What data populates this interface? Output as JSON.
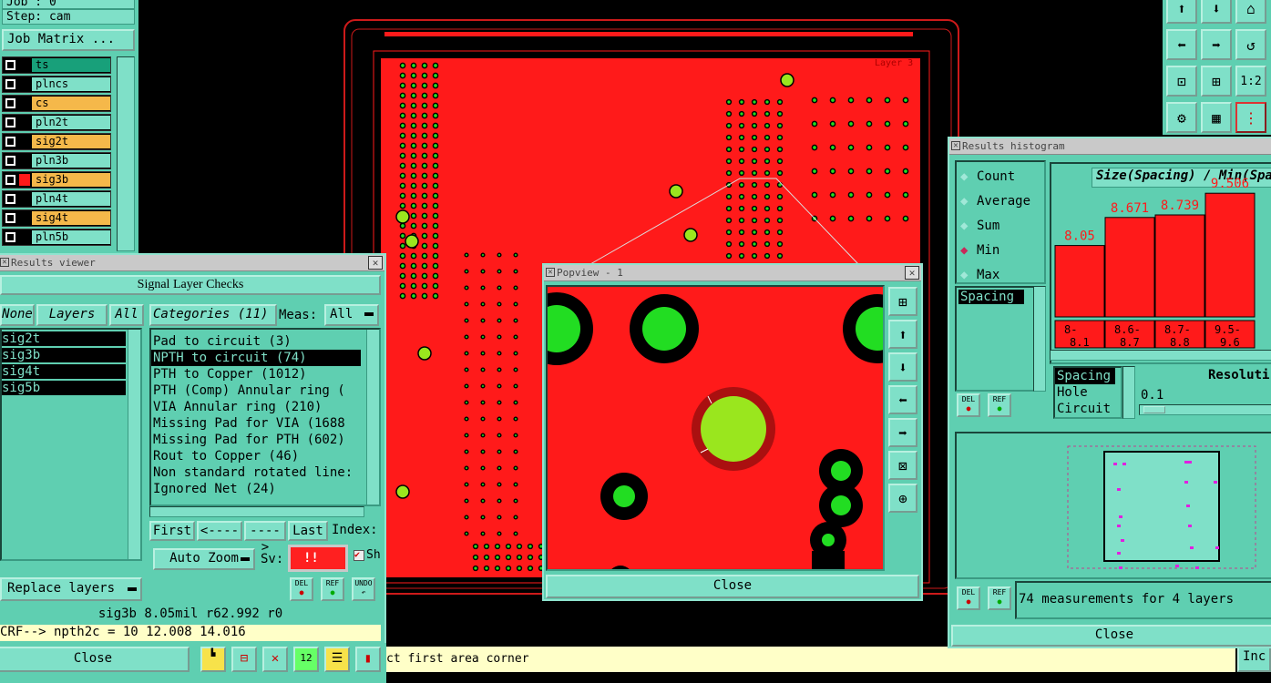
{
  "top_left": {
    "job": "Job : 0",
    "step": "Step: cam",
    "job_matrix": "Job Matrix ..."
  },
  "layers": [
    {
      "name": "ts",
      "color": "#18a07a"
    },
    {
      "name": "plncs",
      "color": "#7fe0c8"
    },
    {
      "name": "cs",
      "color": "#f5b84a"
    },
    {
      "name": "pln2t",
      "color": "#7fe0c8"
    },
    {
      "name": "sig2t",
      "color": "#f5b84a"
    },
    {
      "name": "pln3b",
      "color": "#7fe0c8"
    },
    {
      "name": "sig3b",
      "color": "#f5b84a"
    },
    {
      "name": "pln4t",
      "color": "#7fe0c8"
    },
    {
      "name": "sig4t",
      "color": "#f5b84a"
    },
    {
      "name": "pln5b",
      "color": "#7fe0c8"
    }
  ],
  "results_viewer": {
    "title": "Results viewer",
    "header": "Signal Layer Checks",
    "none": "None",
    "layers_label": "Layers",
    "all": "All",
    "categories_label": "Categories (11)",
    "meas_label": "Meas:",
    "meas_value": "All",
    "layer_list": [
      "sig2t",
      "sig3b",
      "sig4t",
      "sig5b"
    ],
    "categories": [
      "Pad to circuit (3)",
      "NPTH to circuit (74)",
      "PTH to Copper (1012)",
      "PTH (Comp) Annular ring (",
      "VIA Annular ring (210)",
      "Missing Pad for VIA (1688",
      "Missing Pad for PTH (602)",
      "Rout to Copper (46)",
      "Non standard rotated line:",
      "Ignored Net (24)"
    ],
    "first": "First",
    "prev": "<----",
    "next": "---->",
    "last": "Last",
    "index": "Index:",
    "auto_zoom": "Auto Zoom",
    "sv": "Sv:",
    "sv_value": "!!",
    "sh": "Sh",
    "replace_layers": "Replace layers",
    "status": "sig3b 8.05mil  r62.992  r0",
    "formula": "CRF--> npth2c = 10 12.008 14.016",
    "close": "Close",
    "del": "DEL",
    "ref": "REF",
    "undo": "UNDO"
  },
  "popview": {
    "title": "Popview - 1",
    "close": "Close"
  },
  "board": {
    "layer_label": "Layer 3"
  },
  "histogram": {
    "title": "Results histogram",
    "modes": [
      "Count",
      "Average",
      "Sum",
      "Min",
      "Max"
    ],
    "selected_mode": "Min",
    "metric": "Spacing",
    "chart_title": "Size(Spacing) / Min(Spa",
    "bars": [
      {
        "value": "8.05",
        "range_top": "8-",
        "range_bottom": "8.1",
        "height": 0.56
      },
      {
        "value": "8.671",
        "range_top": "8.6-",
        "range_bottom": "8.7",
        "height": 0.78
      },
      {
        "value": "8.739",
        "range_top": "8.7-",
        "range_bottom": "8.8",
        "height": 0.8
      },
      {
        "value": "9.506",
        "range_top": "9.5-",
        "range_bottom": "9.6",
        "height": 0.97
      }
    ],
    "list2": [
      "Spacing",
      "Hole",
      "Circuit"
    ],
    "resolution_label": "Resoluti",
    "resolution_value": "0.1",
    "measurements": "74 measurements for 4 layers",
    "close": "Close",
    "del": "DEL",
    "ref": "REF"
  },
  "status_bar": {
    "message": "ct first area corner",
    "right": "Inc"
  },
  "colors": {
    "panel": "#5fcfb1",
    "board": "#ff1a1a",
    "pad": "#22dd22",
    "selected": "#000000"
  }
}
